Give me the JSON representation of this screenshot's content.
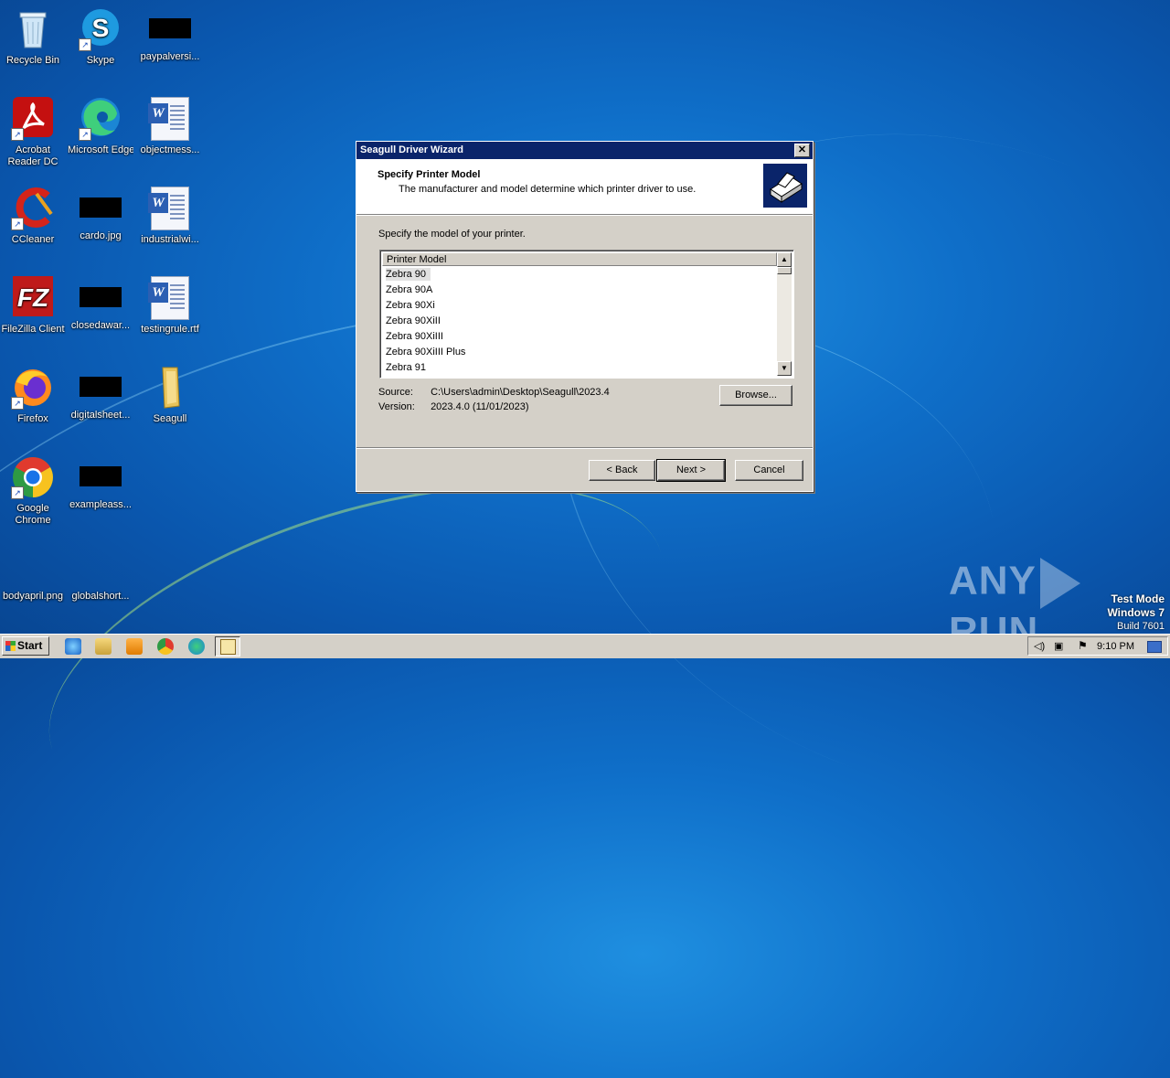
{
  "desktop": {
    "icons": [
      {
        "name": "recycle-bin",
        "label": "Recycle Bin"
      },
      {
        "name": "skype",
        "label": "Skype"
      },
      {
        "name": "paypalversi",
        "label": "paypalversi..."
      },
      {
        "name": "acrobat-reader",
        "label": "Acrobat Reader DC"
      },
      {
        "name": "microsoft-edge",
        "label": "Microsoft Edge"
      },
      {
        "name": "objectmess",
        "label": "objectmess..."
      },
      {
        "name": "ccleaner",
        "label": "CCleaner"
      },
      {
        "name": "cardo",
        "label": "cardo.jpg"
      },
      {
        "name": "industrialwi",
        "label": "industrialwi..."
      },
      {
        "name": "filezilla",
        "label": "FileZilla Client"
      },
      {
        "name": "closedawar",
        "label": "closedawar..."
      },
      {
        "name": "testingrule",
        "label": "testingrule.rtf"
      },
      {
        "name": "firefox",
        "label": "Firefox"
      },
      {
        "name": "digitalsheet",
        "label": "digitalsheet..."
      },
      {
        "name": "seagull-folder",
        "label": "Seagull"
      },
      {
        "name": "google-chrome",
        "label": "Google Chrome"
      },
      {
        "name": "exampleass",
        "label": "exampleass..."
      },
      {
        "name": "bodyapril",
        "label": "bodyapril.png"
      },
      {
        "name": "globalshort",
        "label": "globalshort..."
      }
    ]
  },
  "dialog": {
    "title": "Seagull Driver Wizard",
    "close_symbol": "✕",
    "header_title": "Specify Printer Model",
    "header_subtitle": "The manufacturer and model determine which printer driver to use.",
    "prompt": "Specify the model of your printer.",
    "list_header": "Printer Model",
    "models": [
      "Zebra 90",
      "Zebra 90A",
      "Zebra 90Xi",
      "Zebra 90XiII",
      "Zebra 90XiIII",
      "Zebra 90XiIII Plus",
      "Zebra 91"
    ],
    "selected_model": "Zebra 90",
    "source_label": "Source:",
    "source_value": "C:\\Users\\admin\\Desktop\\Seagull\\2023.4",
    "version_label": "Version:",
    "version_value": "2023.4.0 (11/01/2023)",
    "browse_label": "Browse...",
    "back_label": "< Back",
    "next_label": "Next >",
    "cancel_label": "Cancel"
  },
  "watermark": {
    "brand_left": "ANY",
    "brand_right": "RUN",
    "testmode_title": "Test Mode",
    "os": "Windows 7",
    "build": "Build 7601"
  },
  "taskbar": {
    "start_label": "Start",
    "clock": "9:10 PM"
  }
}
